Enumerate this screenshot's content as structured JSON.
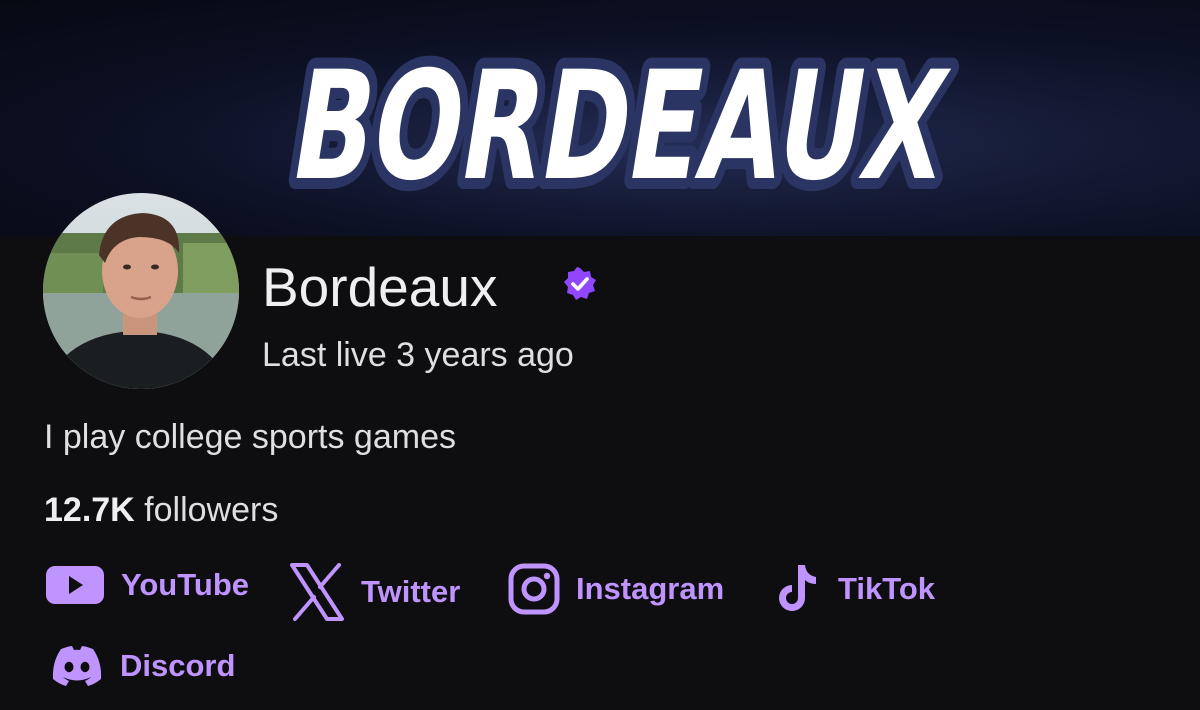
{
  "banner": {
    "title": "BORDEAUX"
  },
  "profile": {
    "display_name": "Bordeaux",
    "verified": true,
    "last_live": "Last live 3 years ago",
    "bio": "I play college sports games",
    "followers_count": "12.7K",
    "followers_label": " followers"
  },
  "socials": [
    {
      "label": "YouTube",
      "icon": "youtube-icon"
    },
    {
      "label": "Twitter",
      "icon": "x-icon"
    },
    {
      "label": "Instagram",
      "icon": "instagram-icon"
    },
    {
      "label": "TikTok",
      "icon": "tiktok-icon"
    },
    {
      "label": "Discord",
      "icon": "discord-icon"
    }
  ],
  "colors": {
    "accent": "#bf94ff",
    "background": "#0e0e10",
    "text": "#efeff1",
    "verified": "#9147ff"
  }
}
